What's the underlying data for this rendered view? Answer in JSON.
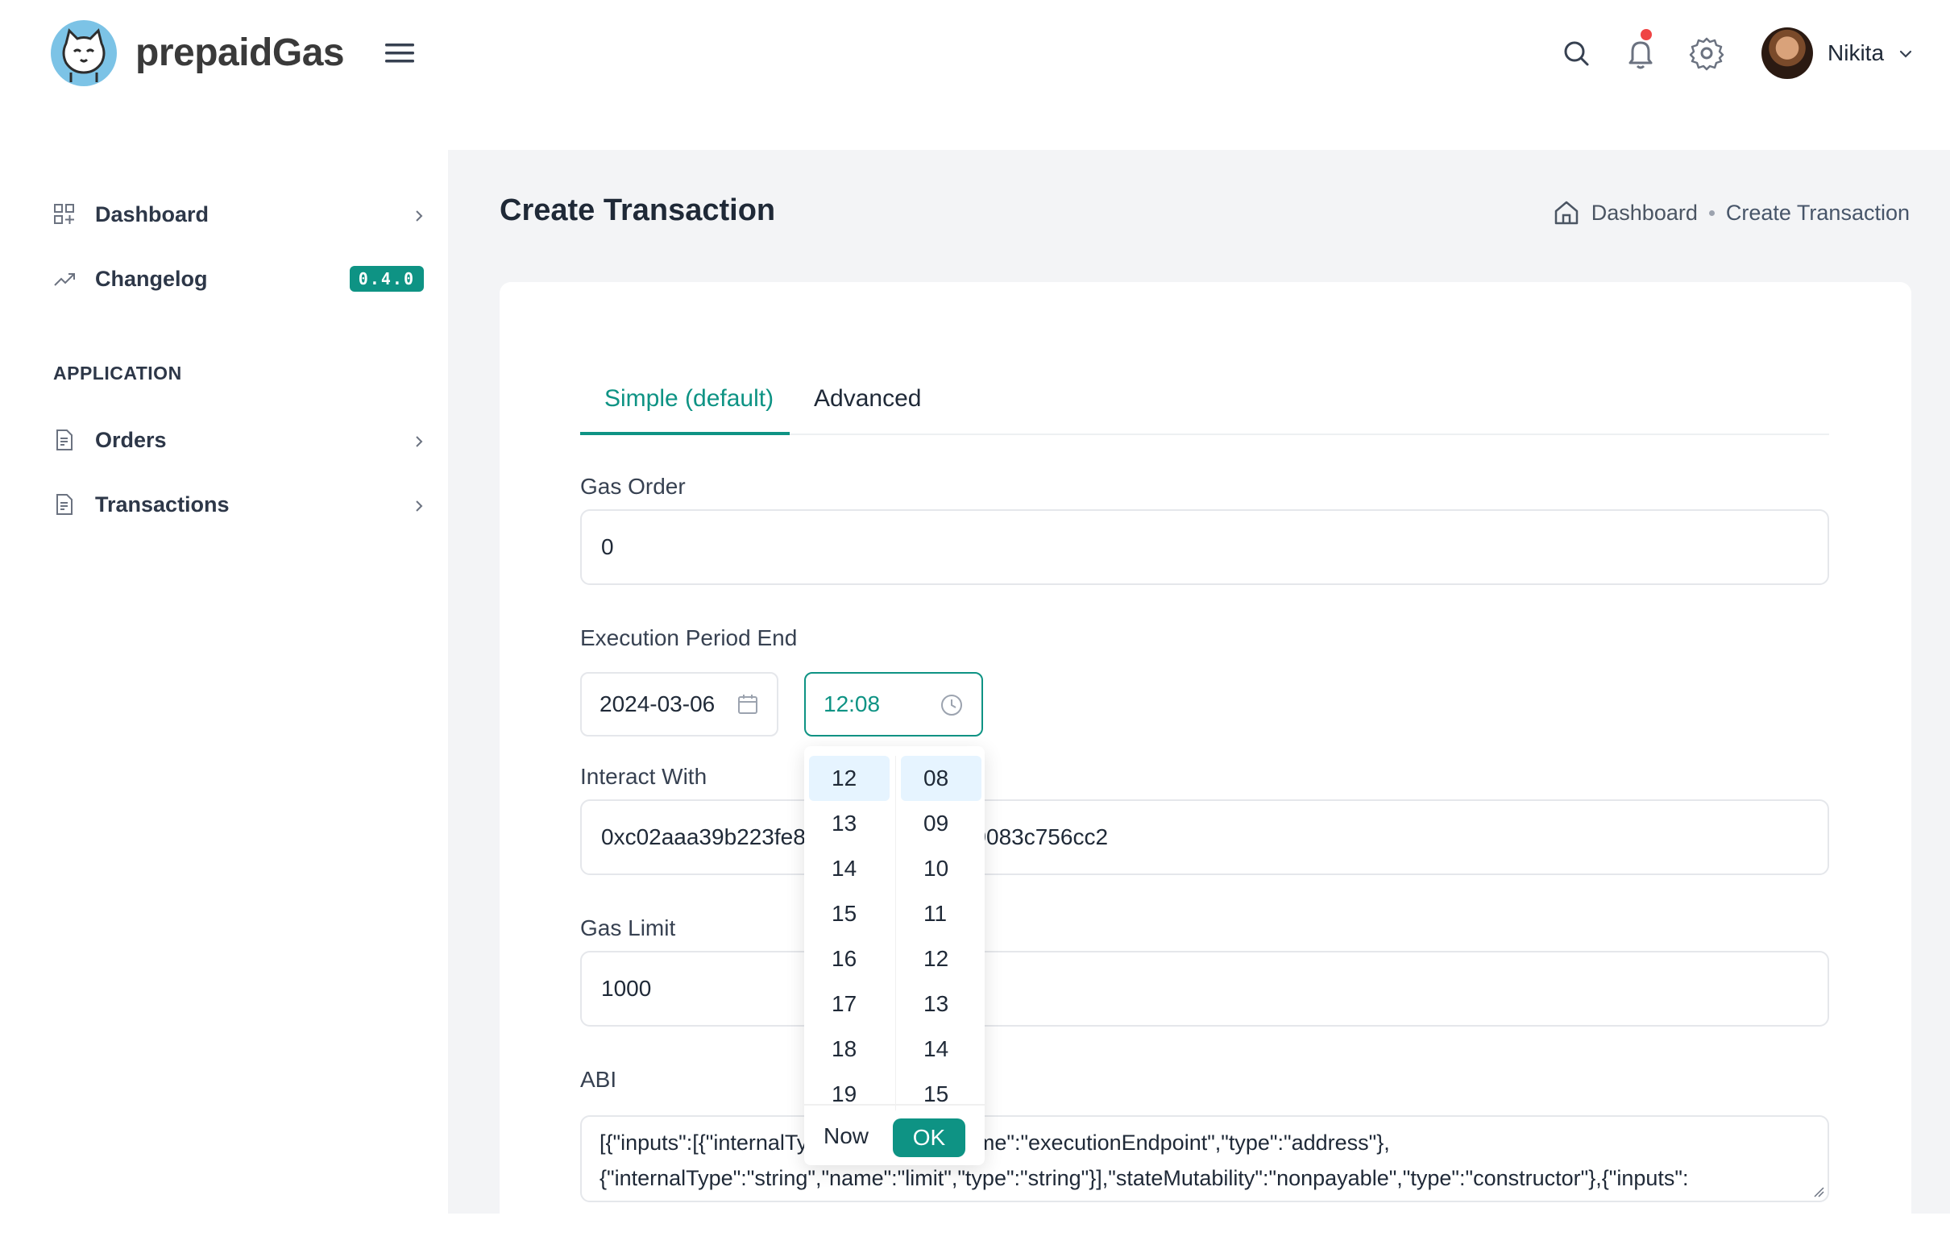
{
  "header": {
    "brand": "prepaidGas",
    "user_name": "Nikita",
    "colors": {
      "accent": "#0e9384",
      "notification": "#ef4444"
    }
  },
  "sidebar": {
    "items": [
      {
        "label": "Dashboard",
        "icon": "grid-icon"
      },
      {
        "label": "Changelog",
        "icon": "trending-up-icon",
        "badge": "0.4.0"
      }
    ],
    "section_title": "APPLICATION",
    "app_items": [
      {
        "label": "Orders",
        "icon": "document-icon"
      },
      {
        "label": "Transactions",
        "icon": "document-icon"
      }
    ]
  },
  "page": {
    "title": "Create Transaction",
    "breadcrumb": {
      "home": "Dashboard",
      "current": "Create Transaction"
    }
  },
  "tabs": [
    {
      "label": "Simple (default)",
      "active": true
    },
    {
      "label": "Advanced",
      "active": false
    }
  ],
  "form": {
    "gas_order": {
      "label": "Gas Order",
      "value": "0"
    },
    "execution_period": {
      "label": "Execution Period End",
      "date": "2024-03-06",
      "time": "12:08"
    },
    "interact_with": {
      "label": "Interact With",
      "value": "0xc02aaa39b223fe8d0a0e5c4f27ead9083c756cc2"
    },
    "gas_limit": {
      "label": "Gas Limit",
      "value": "1000"
    },
    "abi": {
      "label": "ABI",
      "line1": "[{\"inputs\":[{\"internalType\":\"address\",\"name\":\"executionEndpoint\",\"type\":\"address\"},",
      "line2": "{\"internalType\":\"string\",\"name\":\"limit\",\"type\":\"string\"}],\"stateMutability\":\"nonpayable\",\"type\":\"constructor\"},{\"inputs\":"
    }
  },
  "time_picker": {
    "hours": [
      "12",
      "13",
      "14",
      "15",
      "16",
      "17",
      "18",
      "19"
    ],
    "minutes": [
      "08",
      "09",
      "10",
      "11",
      "12",
      "13",
      "14",
      "15"
    ],
    "selected_hour": "12",
    "selected_minute": "08",
    "now_label": "Now",
    "ok_label": "OK"
  }
}
